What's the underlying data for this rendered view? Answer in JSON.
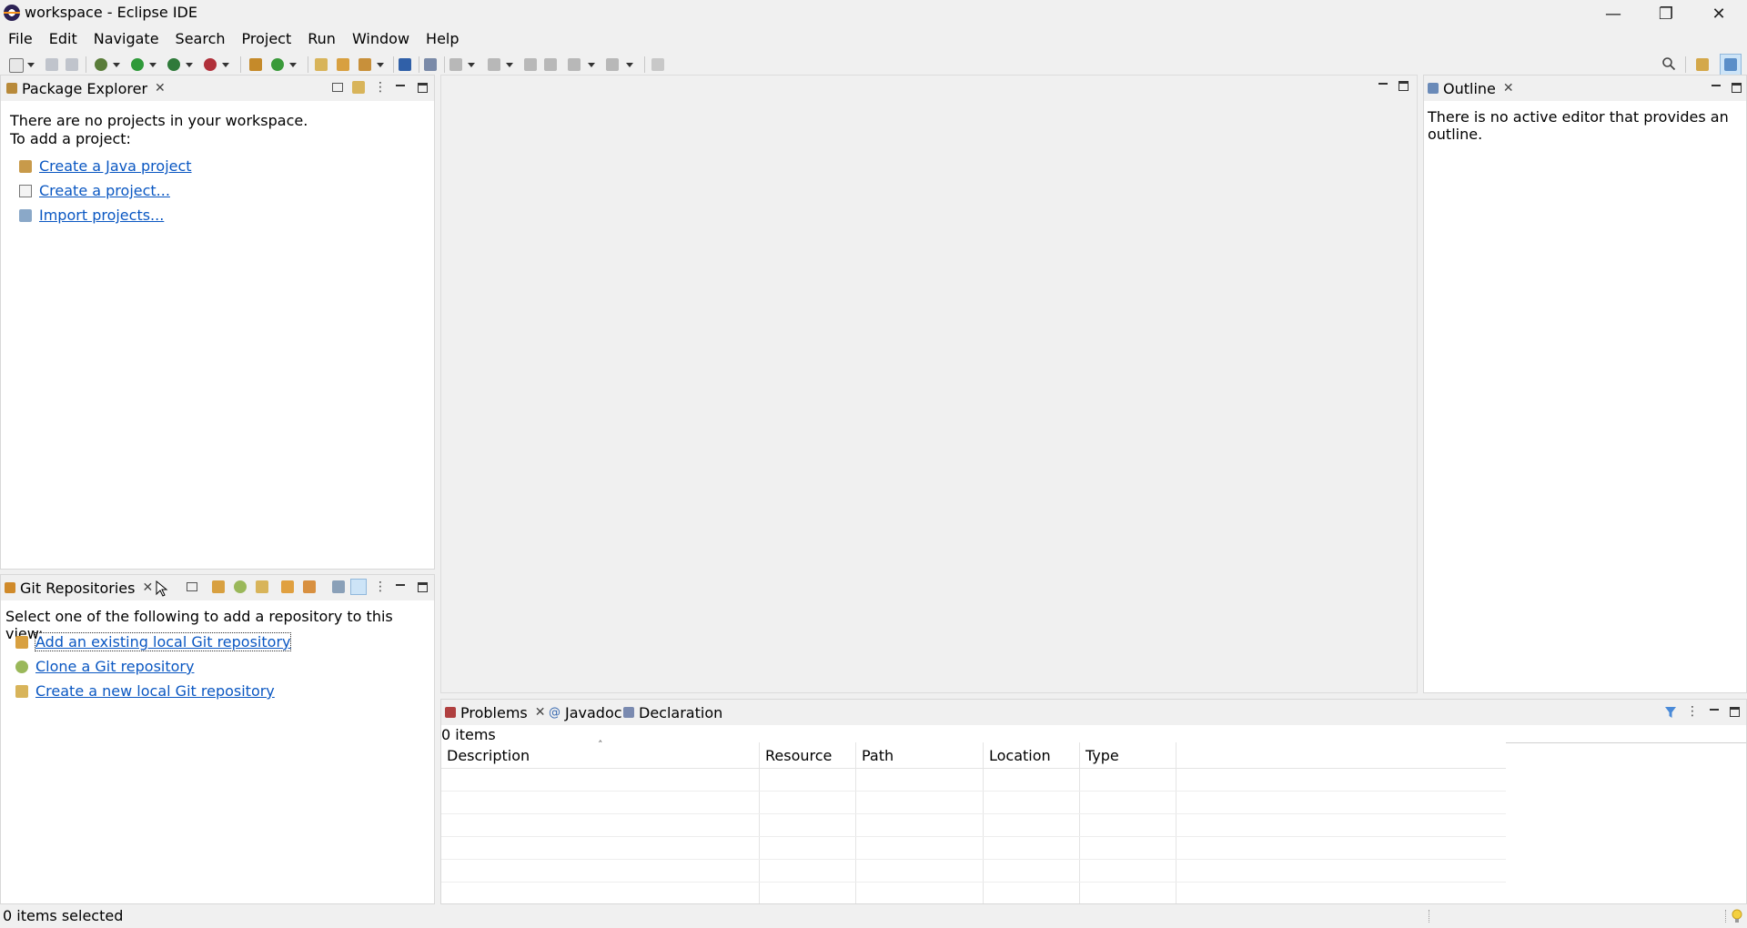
{
  "window": {
    "title": "workspace - Eclipse IDE"
  },
  "menu": [
    "File",
    "Edit",
    "Navigate",
    "Search",
    "Project",
    "Run",
    "Window",
    "Help"
  ],
  "package_explorer": {
    "tab_label": "Package Explorer",
    "message_line1": "There are no projects in your workspace.",
    "message_line2": "To add a project:",
    "links": [
      "Create a Java project",
      "Create a project...",
      "Import projects..."
    ]
  },
  "git_repositories": {
    "tab_label": "Git Repositories",
    "message": "Select one of the following to add a repository to this view:",
    "links": [
      "Add an existing local Git repository",
      "Clone a Git repository",
      "Create a new local Git repository"
    ]
  },
  "outline": {
    "tab_label": "Outline",
    "message": "There is no active editor that provides an outline."
  },
  "bottom_panel": {
    "tabs": [
      "Problems",
      "Javadoc",
      "Declaration"
    ],
    "item_count": "0 items",
    "columns": [
      "Description",
      "Resource",
      "Path",
      "Location",
      "Type"
    ]
  },
  "status": {
    "text": "0 items selected"
  },
  "icons": {
    "window_controls": [
      "minimize-icon",
      "restore-icon",
      "close-icon"
    ],
    "toolbar_right": [
      "search-icon",
      "open-perspective-icon",
      "java-perspective-icon"
    ]
  },
  "colors": {
    "link": "#0a57c2",
    "background": "#f0f0f0",
    "panel": "#ffffff"
  }
}
